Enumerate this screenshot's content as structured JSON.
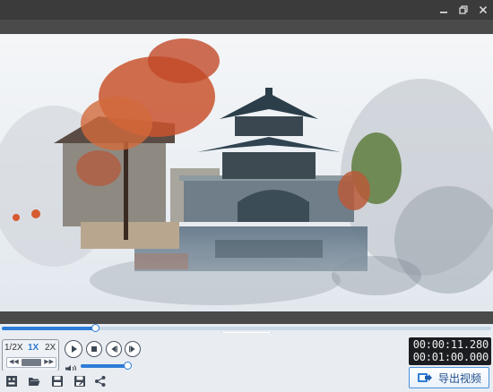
{
  "titlebar": {
    "buttons": {
      "minimize": "minimize-icon",
      "maximize": "restore-icon",
      "close": "close-icon"
    }
  },
  "playback": {
    "speed_options": [
      "1/2X",
      "1X",
      "2X"
    ],
    "selected_speed": "1X",
    "progress_fraction": 0.19,
    "volume_fraction": 0.95,
    "current_time": "00:00:11.280",
    "total_time": "00:01:00.000"
  },
  "toolbar": {
    "tools": [
      "crop-icon",
      "folder-open-icon",
      "save-icon",
      "save-as-icon",
      "share-icon"
    ],
    "export_label": "导出视频"
  },
  "colors": {
    "accent": "#2d7cd6",
    "titlebar": "#3b3b3b",
    "panel": "#e9edf2",
    "time_bg": "#1b1d20"
  }
}
